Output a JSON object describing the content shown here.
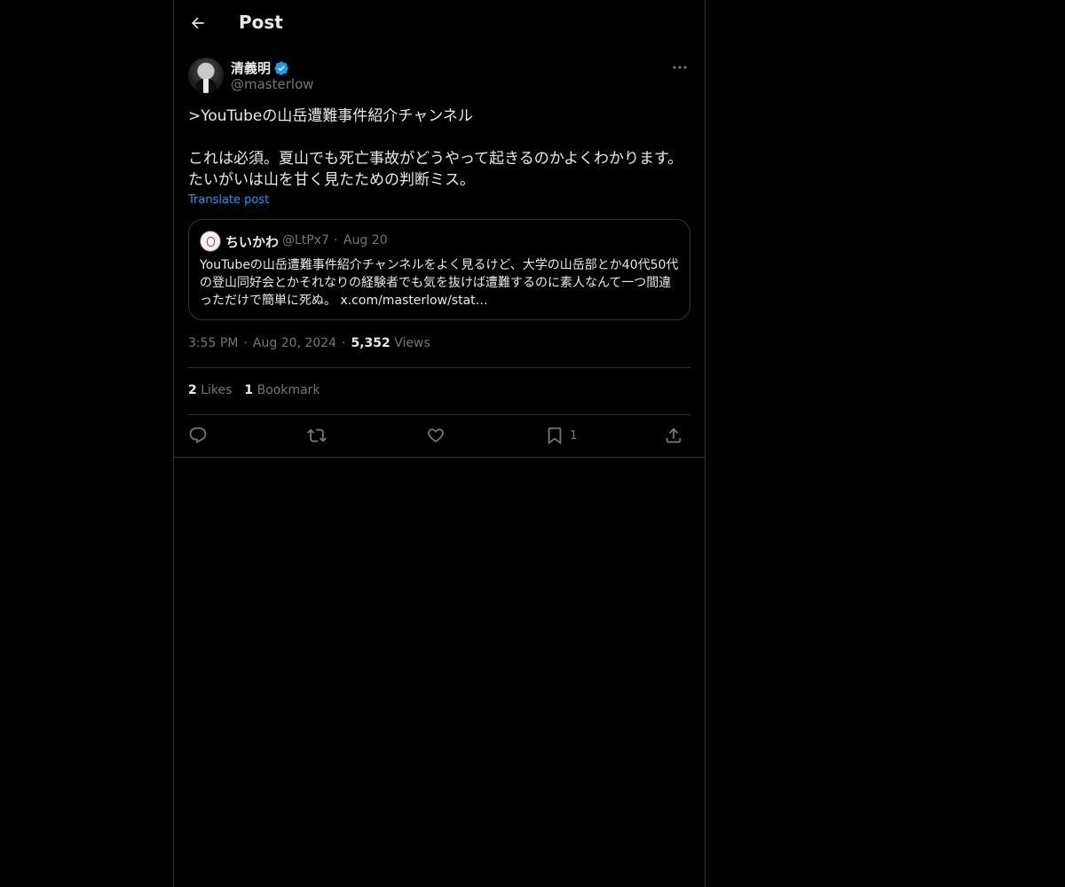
{
  "header": {
    "title": "Post"
  },
  "post": {
    "author": {
      "display_name": "清義明",
      "handle": "@masterlow",
      "verified": true
    },
    "text": ">YouTubeの山岳遭難事件紹介チャンネル\n\nこれは必須。夏山でも死亡事故がどうやって起きるのかよくわかります。\nたいがいは山を甘く見たための判断ミス。",
    "translate_label": "Translate post",
    "quote": {
      "display_name": "ちいかわ",
      "handle": "@LtPx7",
      "separator": "·",
      "date": "Aug 20",
      "text": "YouTubeの山岳遭難事件紹介チャンネルをよく見るけど、大学の山岳部とか40代50代の登山同好会とかそれなりの経験者でも気を抜けば遭難するのに素人なんて一つ間違っただけで簡単に死ぬ。 x.com/masterlow/stat…"
    },
    "meta": {
      "time": "3:55 PM",
      "separator": "·",
      "date": "Aug 20, 2024",
      "views_count": "5,352",
      "views_label": "Views"
    },
    "stats": {
      "likes_count": "2",
      "likes_label": "Likes",
      "bookmarks_count": "1",
      "bookmarks_label": "Bookmark"
    },
    "actions": {
      "bookmark_count": "1"
    }
  },
  "colors": {
    "background": "#000000",
    "text": "#e7e9ea",
    "muted": "#71767b",
    "accent": "#1d9bf0",
    "border": "#2f3336"
  },
  "icons": [
    "back-arrow-icon",
    "verified-badge-icon",
    "more-icon",
    "reply-icon",
    "repost-icon",
    "like-icon",
    "bookmark-icon",
    "share-icon"
  ]
}
